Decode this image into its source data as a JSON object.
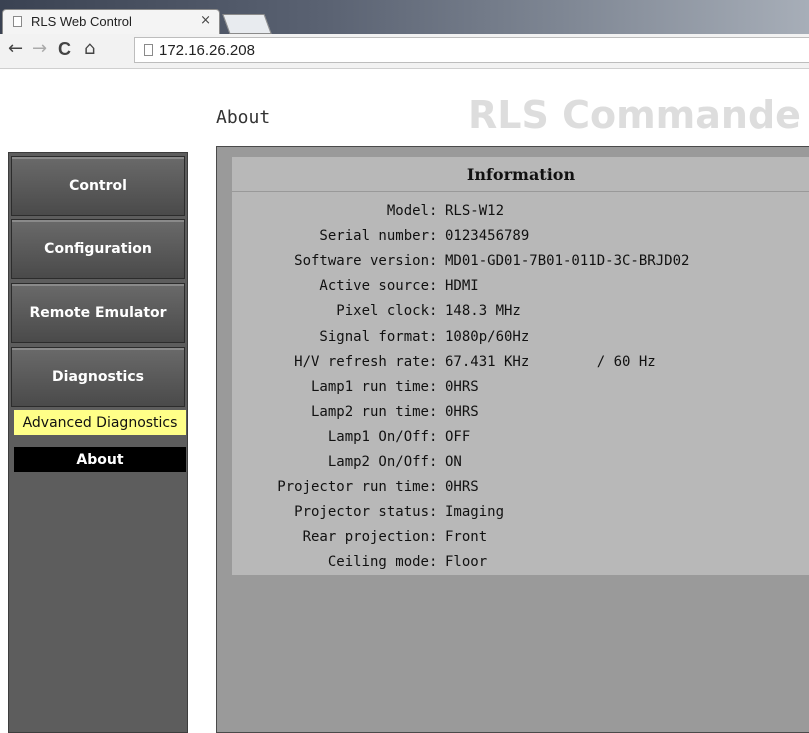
{
  "browser": {
    "tab_title": "RLS Web Control",
    "tab_close": "×",
    "url": "172.16.26.208",
    "back_glyph": "←",
    "forward_glyph": "→",
    "reload_glyph": "C",
    "home_glyph": "⌂"
  },
  "header": {
    "page_title": "About",
    "brand": "RLS Commande"
  },
  "sidebar": {
    "items": [
      {
        "label": "Control"
      },
      {
        "label": "Configuration"
      },
      {
        "label": "Remote Emulator"
      },
      {
        "label": "Diagnostics"
      }
    ],
    "sub_items": [
      {
        "label": "Advanced Diagnostics"
      },
      {
        "label": "About"
      }
    ]
  },
  "info": {
    "heading": "Information",
    "separator": ":",
    "rows": [
      {
        "label": "Model",
        "value": "RLS-W12"
      },
      {
        "label": "Serial number",
        "value": "0123456789"
      },
      {
        "label": "Software version",
        "value": "MD01-GD01-7B01-011D-3C-BRJD02"
      },
      {
        "label": "Active source",
        "value": "HDMI"
      },
      {
        "label": "Pixel clock",
        "value": "148.3 MHz"
      },
      {
        "label": "Signal format",
        "value": "1080p/60Hz"
      },
      {
        "label": "H/V refresh rate",
        "value": "67.431 KHz        / 60 Hz"
      },
      {
        "label": "Lamp1 run time",
        "value": "0HRS"
      },
      {
        "label": "Lamp2 run time",
        "value": "0HRS"
      },
      {
        "label": "Lamp1 On/Off",
        "value": "OFF"
      },
      {
        "label": "Lamp2 On/Off",
        "value": "ON"
      },
      {
        "label": "Projector run time",
        "value": "0HRS"
      },
      {
        "label": "Projector status",
        "value": "Imaging"
      },
      {
        "label": "Rear projection",
        "value": "Front"
      },
      {
        "label": "Ceiling mode",
        "value": "Floor"
      }
    ]
  },
  "colors": {
    "sidebar_bg": "#5d5d5d",
    "advanced_highlight": "#ffff88",
    "about_active": "#000000",
    "info_bg": "#b8b8b8",
    "frame_bg": "#9a9a9a"
  }
}
